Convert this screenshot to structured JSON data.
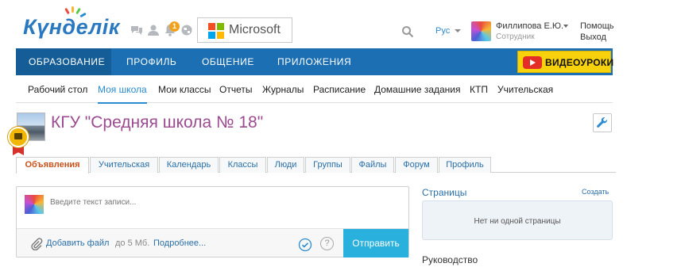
{
  "app": {
    "logo_text": "Күнделік"
  },
  "header": {
    "microsoft_label": "Microsoft",
    "notification_count": "1",
    "language": "Рус",
    "user_name": "Филлипова Е.Ю.",
    "user_role": "Сотрудник",
    "help_label": "Помощь",
    "exit_label": "Выход"
  },
  "main_nav": {
    "items": [
      "ОБРАЗОВАНИЕ",
      "ПРОФИЛЬ",
      "ОБЩЕНИЕ",
      "ПРИЛОЖЕНИЯ"
    ],
    "active": "ОБРАЗОВАНИЕ",
    "video_label": "ВИДЕОУРОКИ"
  },
  "sub_nav": {
    "items": [
      "Рабочий стол",
      "Моя школа",
      "Мои классы",
      "Отчеты",
      "Журналы",
      "Расписание",
      "Домашние задания",
      "КТП",
      "Учительская"
    ],
    "active": "Моя школа"
  },
  "school": {
    "title": "КГУ \"Средняя школа № 18\""
  },
  "tabs": {
    "items": [
      "Объявления",
      "Учительская",
      "Календарь",
      "Классы",
      "Люди",
      "Группы",
      "Файлы",
      "Форум",
      "Профиль"
    ],
    "active": "Объявления"
  },
  "post": {
    "placeholder": "Введите текст записи...",
    "add_file": "Добавить файл",
    "file_limit": "до 5 Мб.",
    "more": "Подробнее...",
    "help_symbol": "?",
    "send": "Отправить"
  },
  "sidebar": {
    "pages_title": "Страницы",
    "create_label": "Создать",
    "pages_empty": "Нет ни одной страницы",
    "management_title": "Руководство"
  },
  "colors": {
    "nav_blue": "#1c6fb3",
    "accent_blue": "#2a8bd0",
    "title_purple": "#9b4a8f",
    "active_tab": "#c8541b",
    "send_button": "#2ab0dd",
    "video_yellow": "#f6d10c"
  }
}
